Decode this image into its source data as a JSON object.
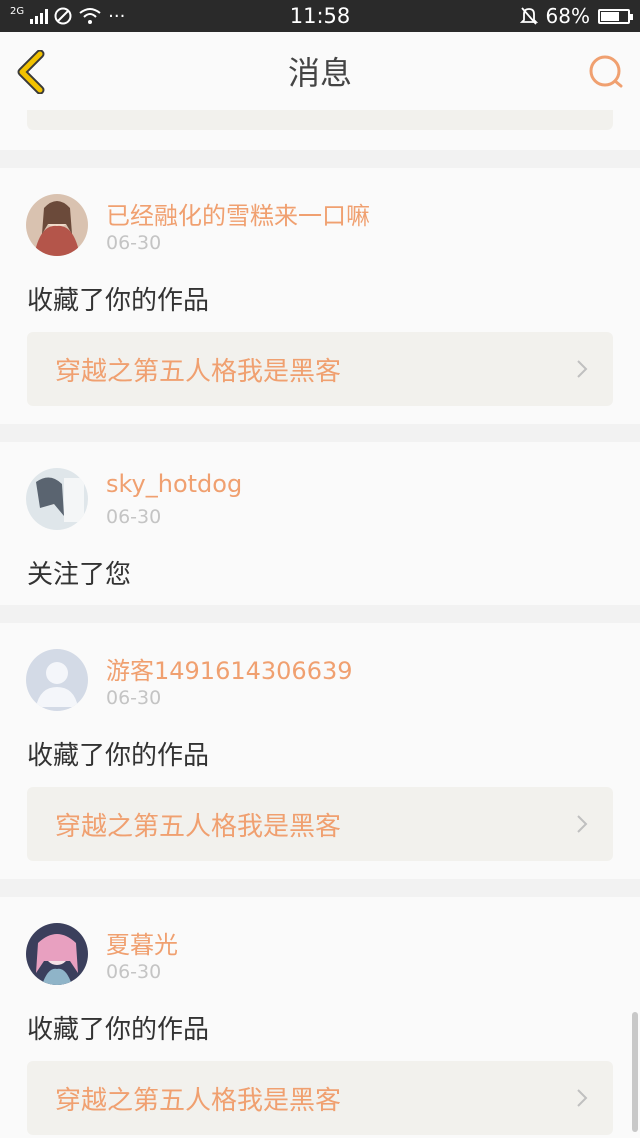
{
  "status_bar": {
    "network": "2G",
    "time": "11:58",
    "battery": "68%",
    "battery_level": 0.68,
    "more": "···"
  },
  "header": {
    "title": "消息",
    "back_icon": "chevron-left-icon",
    "search_icon": "search-icon"
  },
  "notifications": [
    {
      "user": "已经融化的雪糕来一口嘛",
      "date": "06-30",
      "action": "收藏了你的作品",
      "work_title": "穿越之第五人格我是黑客"
    },
    {
      "user": "sky_hotdog",
      "date": "06-30",
      "action": "关注了您",
      "work_title": ""
    },
    {
      "user": "游客1491614306639",
      "date": "06-30",
      "action": "收藏了你的作品",
      "work_title": "穿越之第五人格我是黑客"
    },
    {
      "user": "夏暮光",
      "date": "06-30",
      "action": "收藏了你的作品",
      "work_title": "穿越之第五人格我是黑客"
    }
  ],
  "colors": {
    "accent": "#f0a070",
    "back_icon": "#f2c200"
  }
}
